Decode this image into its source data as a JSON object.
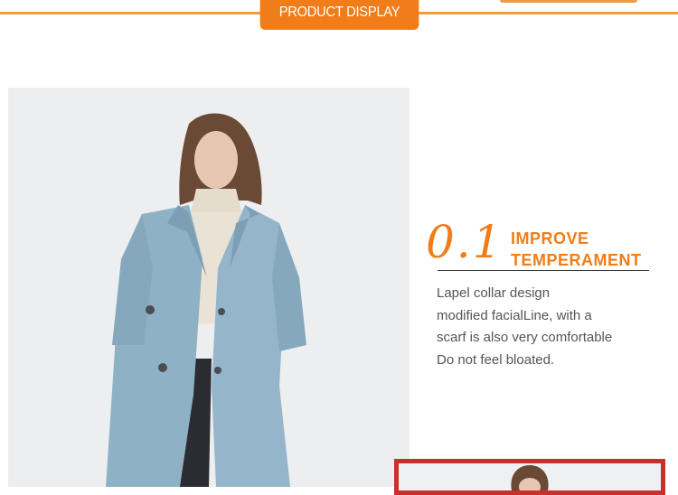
{
  "header": {
    "tab_label": "PRODUCT DISPLAY",
    "accent_color": "#f07d1a"
  },
  "feature": {
    "number": "0.1",
    "heading_line1": "IMPROVE",
    "heading_line2": "TEMPERAMENT",
    "description_lines": [
      "Lapel collar design",
      "modified facialLine, with a",
      "scarf is also very comfortable",
      "Do not feel bloated."
    ]
  },
  "images": {
    "main_photo": "model wearing light blue wool coat over beige turtleneck",
    "thumbnail_photo": "model portrait thumbnail"
  }
}
